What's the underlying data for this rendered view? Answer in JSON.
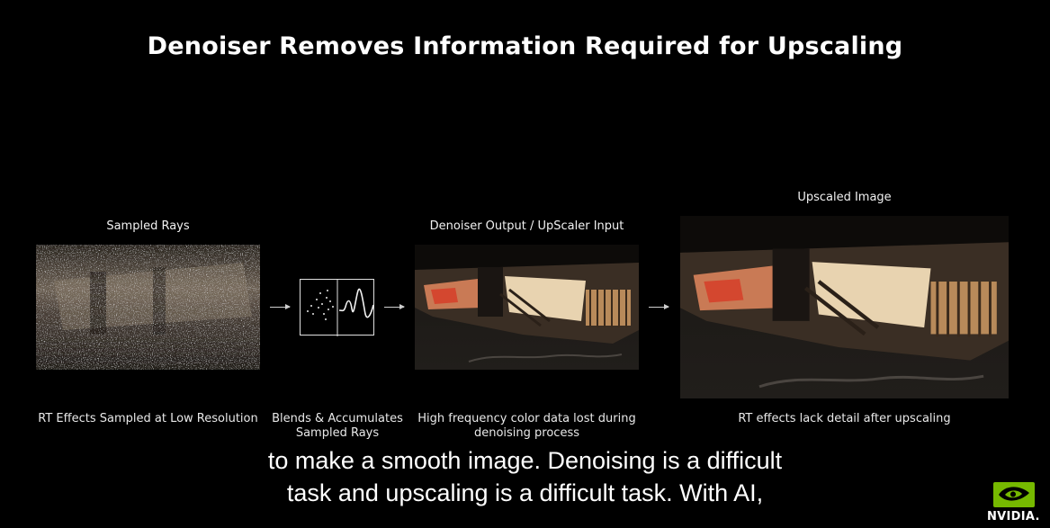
{
  "slide": {
    "title": "Denoiser Removes Information Required for Upscaling"
  },
  "panels": [
    {
      "label": "Sampled Rays",
      "caption": "RT Effects Sampled at Low Resolution"
    },
    {
      "label": "",
      "caption": "Blends & Accumulates\nSampled Rays"
    },
    {
      "label": "Denoiser Output / UpScaler Input",
      "caption": "High frequency color data lost during\ndenoising process"
    },
    {
      "label": "Upscaled Image",
      "caption": "RT effects lack detail after upscaling"
    }
  ],
  "subtitles": {
    "line1": "to make a smooth image. Denoising is a difficult",
    "line2": "task and upscaling is a difficult task. With AI,"
  },
  "brand": {
    "name": "NVIDIA.",
    "color": "#76b900"
  }
}
